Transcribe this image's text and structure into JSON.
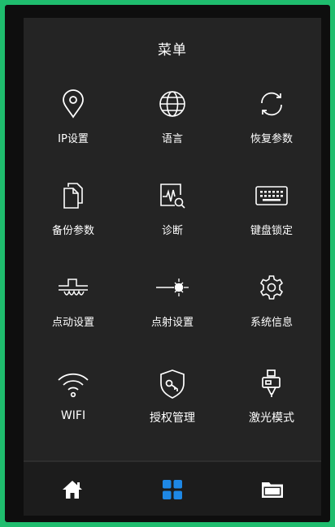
{
  "header": {
    "title": "菜单"
  },
  "menu": {
    "items": [
      {
        "label": "IP设置",
        "icon": "location-pin-icon"
      },
      {
        "label": "语言",
        "icon": "globe-icon"
      },
      {
        "label": "恢复参数",
        "icon": "refresh-icon"
      },
      {
        "label": "备份参数",
        "icon": "copy-documents-icon"
      },
      {
        "label": "诊断",
        "icon": "diagnostics-icon"
      },
      {
        "label": "键盘锁定",
        "icon": "keyboard-icon"
      },
      {
        "label": "点动设置",
        "icon": "jog-pulse-icon"
      },
      {
        "label": "点射设置",
        "icon": "laser-burst-icon"
      },
      {
        "label": "系统信息",
        "icon": "gear-icon"
      },
      {
        "label": "WIFI",
        "icon": "wifi-icon"
      },
      {
        "label": "授权管理",
        "icon": "shield-key-icon"
      },
      {
        "label": "激光模式",
        "icon": "laser-head-icon"
      }
    ]
  },
  "bottom_nav": {
    "items": [
      {
        "name": "home",
        "icon": "home-icon",
        "active": false
      },
      {
        "name": "menu",
        "icon": "grid-icon",
        "active": true
      },
      {
        "name": "files",
        "icon": "folder-icon",
        "active": false
      }
    ]
  },
  "colors": {
    "accent": "#1e88e5",
    "frame": "#1fbd6e",
    "background": "#242424",
    "text": "#ffffff"
  }
}
